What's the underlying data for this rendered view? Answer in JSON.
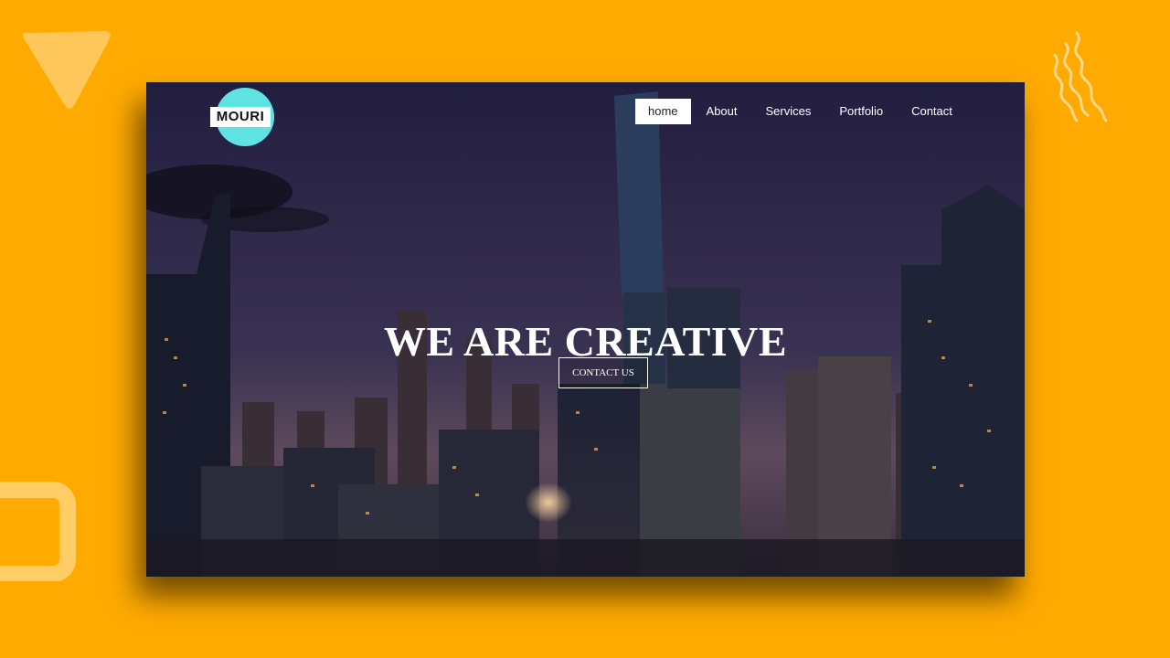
{
  "colors": {
    "background": "#FFAA00",
    "logo_circle": "#5fe3e3",
    "sky_top": "#231f42",
    "sky_bottom": "#5a4b63",
    "text": "#ffffff"
  },
  "icons": {
    "triangle": "triangle-decoration-icon",
    "waves": "waves-decoration-icon",
    "square": "rounded-square-decoration-icon"
  },
  "brand": {
    "logo_text": "MOURI"
  },
  "nav": {
    "items": [
      {
        "label": "home",
        "active": true
      },
      {
        "label": "About",
        "active": false
      },
      {
        "label": "Services",
        "active": false
      },
      {
        "label": "Portfolio",
        "active": false
      },
      {
        "label": "Contact",
        "active": false
      }
    ]
  },
  "hero": {
    "title": "WE ARE CREATIVE",
    "cta_label": "CONTACT US"
  }
}
